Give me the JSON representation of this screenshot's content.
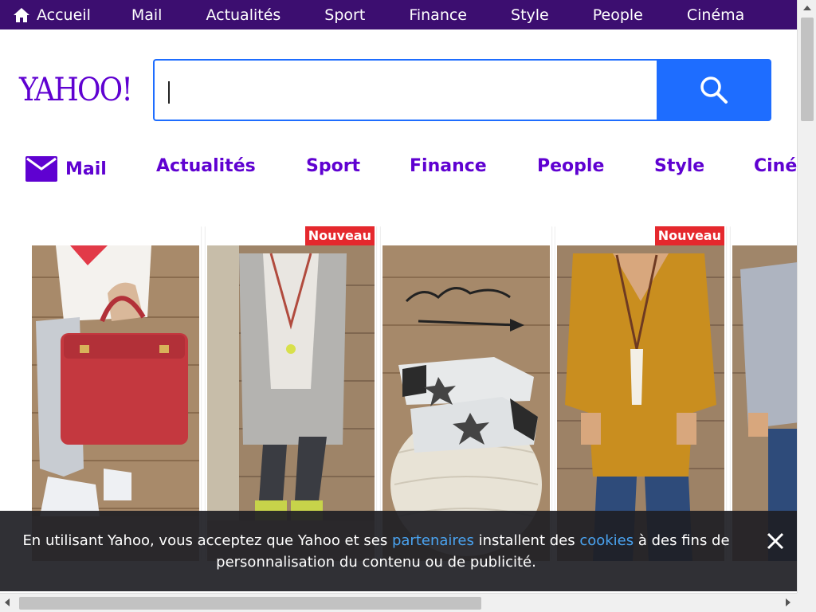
{
  "topnav": {
    "home": "Accueil",
    "items": [
      "Mail",
      "Actualités",
      "Sport",
      "Finance",
      "Style",
      "People",
      "Cinéma"
    ]
  },
  "logo": "YAHOO!",
  "search": {
    "value": "",
    "placeholder": ""
  },
  "subnav": [
    "Mail",
    "Actualités",
    "Sport",
    "Finance",
    "People",
    "Style",
    "Ciné"
  ],
  "cards": [
    {
      "badge": ""
    },
    {
      "badge": "Nouveau"
    },
    {
      "badge": ""
    },
    {
      "badge": "Nouveau"
    },
    {
      "badge": ""
    }
  ],
  "cookie": {
    "text_before": "En utilisant Yahoo, vous acceptez que Yahoo et ses ",
    "link_partners": "partenaires",
    "text_middle": " installent des ",
    "link_cookies": "cookies",
    "text_after": " à des fins de personnalisation du contenu ou de publicité."
  },
  "colors": {
    "topbar": "#3c0e70",
    "brand": "#5f01d1",
    "search_button": "#1e6dff",
    "badge": "#e5282d",
    "link": "#4aa3f0"
  },
  "icons": [
    "home-icon",
    "search-icon",
    "mail-icon",
    "close-icon"
  ]
}
